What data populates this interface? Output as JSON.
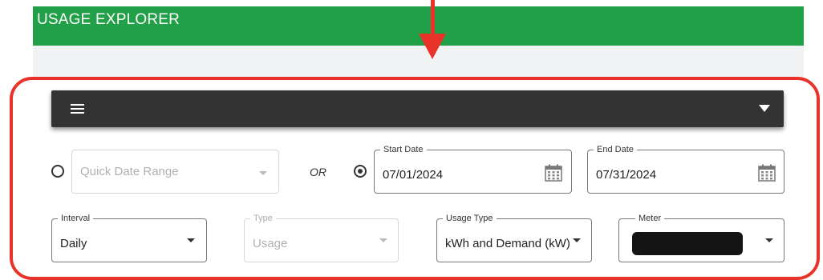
{
  "header": {
    "title": "USAGE EXPLORER"
  },
  "filters": {
    "quick_range": {
      "placeholder": "Quick Date Range",
      "selected": false
    },
    "or_label": "OR",
    "custom_range": {
      "selected": true
    },
    "start_date": {
      "label": "Start Date",
      "value": "07/01/2024"
    },
    "end_date": {
      "label": "End Date",
      "value": "07/31/2024"
    },
    "interval": {
      "label": "Interval",
      "value": "Daily"
    },
    "type": {
      "label": "Type",
      "value": "Usage",
      "disabled": true
    },
    "usage_type": {
      "label": "Usage Type",
      "value": "kWh and Demand (kW)"
    },
    "meter": {
      "label": "Meter",
      "value_redacted": true
    }
  },
  "colors": {
    "header_bg": "#22a047",
    "toolbar_bg": "#333334",
    "annotation_red": "#e8322a",
    "panel_bg": "#f1f2f3"
  },
  "icons": [
    "hamburger-menu-icon",
    "chevron-down-icon",
    "calendar-icon",
    "red-arrow-annotation"
  ]
}
